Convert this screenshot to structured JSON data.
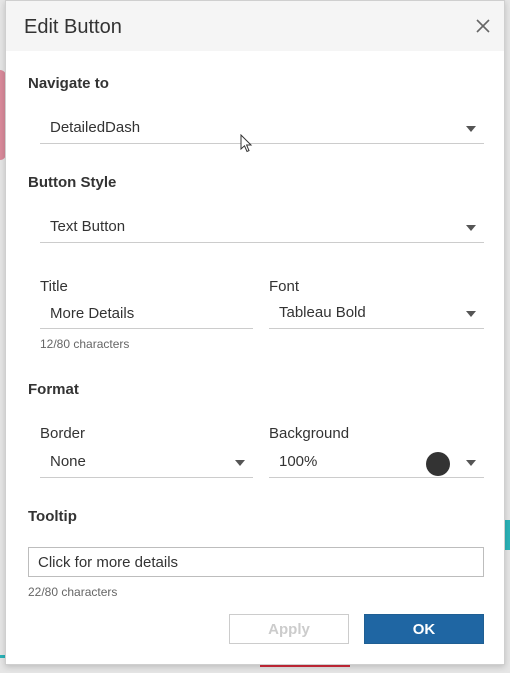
{
  "dialog": {
    "title": "Edit Button",
    "close_icon": "close-icon"
  },
  "navigate": {
    "section_label": "Navigate to",
    "selected": "DetailedDash"
  },
  "button_style": {
    "section_label": "Button Style",
    "selected": "Text Button",
    "title_label": "Title",
    "title_value": "More Details",
    "title_count": "12/80 characters",
    "font_label": "Font",
    "font_value": "Tableau Bold"
  },
  "format": {
    "section_label": "Format",
    "border_label": "Border",
    "border_value": "None",
    "background_label": "Background",
    "background_value": "100%",
    "background_color": "#333333"
  },
  "tooltip": {
    "section_label": "Tooltip",
    "value": "Click for more details",
    "count": "22/80 characters"
  },
  "footer": {
    "apply_label": "Apply",
    "ok_label": "OK"
  },
  "colors": {
    "accent": "#1f66a3"
  }
}
